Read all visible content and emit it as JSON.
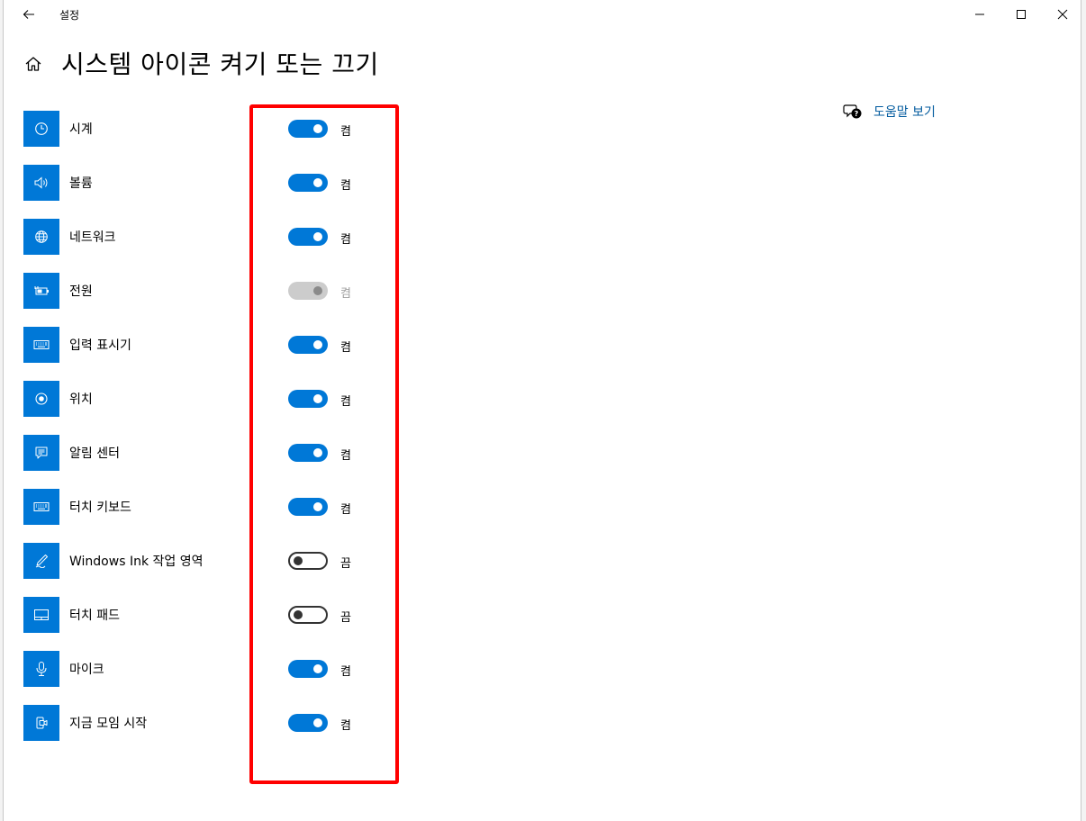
{
  "window": {
    "title": "설정"
  },
  "header": {
    "title": "시스템 아이콘 켜기 또는 끄기"
  },
  "help": {
    "label": "도움말 보기",
    "icon": "help-chat-icon"
  },
  "colors": {
    "accent": "#0078d7",
    "highlight": "#ff0000",
    "link": "#005a9e"
  },
  "items": [
    {
      "label": "시계",
      "icon": "clock-icon",
      "state": "on",
      "state_label": "켬"
    },
    {
      "label": "볼륨",
      "icon": "volume-icon",
      "state": "on",
      "state_label": "켬"
    },
    {
      "label": "네트워크",
      "icon": "globe-icon",
      "state": "on",
      "state_label": "켬"
    },
    {
      "label": "전원",
      "icon": "battery-plug-icon",
      "state": "disabled",
      "state_label": "켬"
    },
    {
      "label": "입력 표시기",
      "icon": "keyboard-icon",
      "state": "on",
      "state_label": "켬"
    },
    {
      "label": "위치",
      "icon": "location-icon",
      "state": "on",
      "state_label": "켬"
    },
    {
      "label": "알림 센터",
      "icon": "action-center-icon",
      "state": "on",
      "state_label": "켬"
    },
    {
      "label": "터치 키보드",
      "icon": "touch-keyboard-icon",
      "state": "on",
      "state_label": "켬"
    },
    {
      "label": "Windows Ink 작업 영역",
      "icon": "pen-icon",
      "state": "off",
      "state_label": "끔"
    },
    {
      "label": "터치 패드",
      "icon": "touchpad-icon",
      "state": "off",
      "state_label": "끔"
    },
    {
      "label": "마이크",
      "icon": "microphone-icon",
      "state": "on",
      "state_label": "켬"
    },
    {
      "label": "지금 모임 시작",
      "icon": "meet-now-icon",
      "state": "on",
      "state_label": "켬"
    }
  ]
}
